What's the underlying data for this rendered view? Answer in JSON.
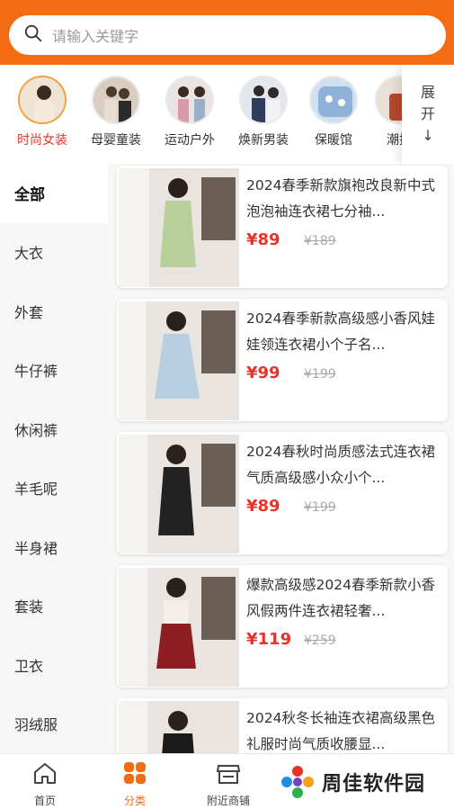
{
  "search": {
    "placeholder": "请输入关键字"
  },
  "categories": [
    {
      "label": "时尚女装",
      "active": true
    },
    {
      "label": "母婴童装"
    },
    {
      "label": "运动户外"
    },
    {
      "label": "焕新男装"
    },
    {
      "label": "保暖馆"
    },
    {
      "label": "潮搭"
    }
  ],
  "expand": {
    "line1": "展",
    "line2": "开",
    "arrow": "↓"
  },
  "sidebar": {
    "items": [
      {
        "label": "全部",
        "active": true
      },
      {
        "label": "大衣"
      },
      {
        "label": "外套"
      },
      {
        "label": "牛仔裤"
      },
      {
        "label": "休闲裤"
      },
      {
        "label": "羊毛呢"
      },
      {
        "label": "半身裙"
      },
      {
        "label": "套装"
      },
      {
        "label": "卫衣"
      },
      {
        "label": "羽绒服"
      }
    ]
  },
  "products": [
    {
      "title": "2024春季新款旗袍改良新中式泡泡袖连衣裙七分袖...",
      "price": "¥89",
      "orig": "¥189",
      "dress": "#b9cf9a"
    },
    {
      "title": "2024春季新款高级感小香风娃娃领连衣裙小个子名...",
      "price": "¥99",
      "orig": "¥199",
      "dress": "#b8cfe2"
    },
    {
      "title": "2024春秋时尚质感法式连衣裙气质高级感小众小个...",
      "price": "¥89",
      "orig": "¥199",
      "dress": "#222222"
    },
    {
      "title": "爆款高级感2024春季新款小香风假两件连衣裙轻奢...",
      "price": "¥119",
      "orig": "¥259",
      "dress": "#8e1e24"
    },
    {
      "title": "2024秋冬长袖连衣裙高级黑色礼服时尚气质收腰显...",
      "price": "",
      "orig": "",
      "dress": "#1a1a1a"
    }
  ],
  "tabbar": {
    "items": [
      {
        "label": "首页",
        "icon": "home-icon"
      },
      {
        "label": "分类",
        "icon": "grid-icon",
        "active": true
      },
      {
        "label": "附近商铺",
        "icon": "store-icon"
      }
    ]
  },
  "watermark": {
    "text": "周佳软件园"
  },
  "colors": {
    "accent": "#f46c12",
    "price": "#e8332a",
    "active_category": "#e8372a"
  }
}
